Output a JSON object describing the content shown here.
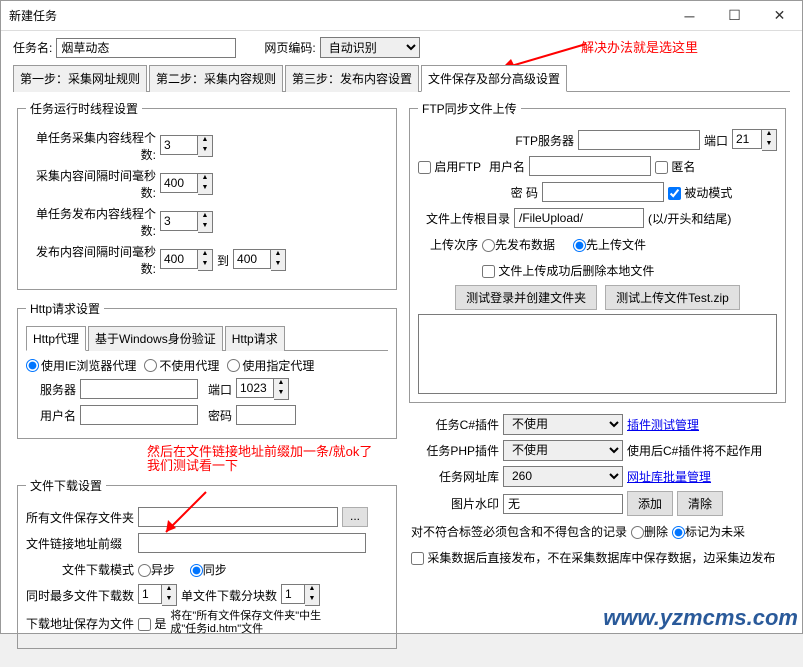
{
  "window_title": "新建任务",
  "row1": {
    "task_name_label": "任务名:",
    "task_name_value": "烟草动态",
    "page_encoding_label": "网页编码:",
    "page_encoding_value": "自动识别"
  },
  "tabs": [
    "第一步：采集网址规则",
    "第二步：采集内容规则",
    "第三步：发布内容设置",
    "文件保存及部分高级设置"
  ],
  "group_thread": {
    "legend": "任务运行时线程设置",
    "single_collect_label": "单任务采集内容线程个数:",
    "single_collect_val": "3",
    "collect_interval_label": "采集内容间隔时间毫秒数:",
    "collect_interval_val": "400",
    "single_publish_label": "单任务发布内容线程个数:",
    "single_publish_val": "3",
    "publish_interval_label": "发布内容间隔时间毫秒数:",
    "publish_interval_val": "400",
    "to_label": "到",
    "publish_interval_to": "400"
  },
  "group_http": {
    "legend": "Http请求设置",
    "subtabs": [
      "Http代理",
      "基于Windows身份验证",
      "Http请求"
    ],
    "r_ie": "使用IE浏览器代理",
    "r_none": "不使用代理",
    "r_custom": "使用指定代理",
    "server_label": "服务器",
    "server_val": "",
    "port_label": "端口",
    "port_val": "1023",
    "user_label": "用户名",
    "user_val": "",
    "pass_label": "密码",
    "pass_val": ""
  },
  "annotation1": "解决办法就是选这里",
  "annotation2_l1": "然后在文件链接地址前缀加一条/就ok了",
  "annotation2_l2": "我们测试看一下",
  "group_download": {
    "legend": "文件下载设置",
    "save_folder_label": "所有文件保存文件夹",
    "save_folder_val": "",
    "prefix_label": "文件链接地址前缀",
    "prefix_val": "",
    "mode_label": "文件下载模式",
    "mode_async": "异步",
    "mode_sync": "同步",
    "max_label": "同时最多文件下载数",
    "max_val": "1",
    "chunk_label": "单文件下载分块数",
    "chunk_val": "1",
    "saveas_label": "下载地址保存为文件",
    "saveas_yes": "是",
    "saveas_note": "将在\"所有文件保存文件夹\"中生成\"任务id.htm\"文件"
  },
  "group_ftp": {
    "legend": "FTP同步文件上传",
    "server_label": "FTP服务器",
    "server_val": "",
    "port_label": "端口",
    "port_val": "21",
    "enable_label": "启用FTP",
    "user_label": "用户名",
    "user_val": "",
    "anon_label": "匿名",
    "pass_label": "密   码",
    "pass_val": "",
    "passive_label": "被动模式",
    "root_label": "文件上传根目录",
    "root_val": "/FileUpload/",
    "root_hint": "(以/开头和结尾)",
    "order_label": "上传次序",
    "r_pub_first": "先发布数据",
    "r_up_first": "先上传文件",
    "del_after_label": "文件上传成功后删除本地文件",
    "btn_test_login": "测试登录并创建文件夹",
    "btn_test_upload": "测试上传文件Test.zip"
  },
  "right_bottom": {
    "cs_label": "任务C#插件",
    "cs_val": "不使用",
    "cs_link": "插件测试管理",
    "php_label": "任务PHP插件",
    "php_val": "不使用",
    "php_note": "使用后C#插件将不起作用",
    "db_label": "任务网址库",
    "db_val": "260",
    "db_link": "网址库批量管理",
    "wm_label": "图片水印",
    "wm_val": "无",
    "btn_add": "添加",
    "btn_clear": "清除",
    "tag_label": "对不符合标签必须包含和不得包含的记录",
    "r_del": "删除",
    "r_mark": "标记为未采",
    "direct_label": "采集数据后直接发布，不在采集数据库中保存数据，边采集边发布"
  },
  "watermark": "www.yzmcms.com"
}
